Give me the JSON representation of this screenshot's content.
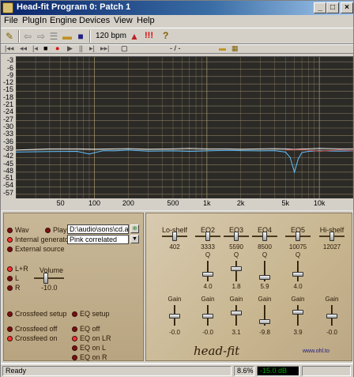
{
  "window": {
    "title": "Head-fit Program 0: Patch   1",
    "controls": {
      "minimize": "_",
      "maximize": "□",
      "close": "×"
    }
  },
  "menu": [
    "File",
    "PlugIn",
    "Engine",
    "Devices",
    "View",
    "Help"
  ],
  "toolbar": {
    "bpm": "120 bpm",
    "alert": "!!!",
    "help": "?"
  },
  "transport": {
    "position": "- / -"
  },
  "graph": {
    "y_ticks": [
      "-3",
      "-6",
      "-9",
      "-12",
      "-15",
      "-18",
      "-21",
      "-24",
      "-27",
      "-30",
      "-33",
      "-36",
      "-39",
      "-42",
      "-45",
      "-48",
      "-51",
      "-54",
      "-57"
    ],
    "x_ticks": [
      "50",
      "100",
      "200",
      "500",
      "1k",
      "2k",
      "5k",
      "10k"
    ],
    "background": "#2b2a27",
    "grid_color": "#a89870",
    "curve_white": "#f0f0f0",
    "curve_blue": "#60c0ff",
    "curve_red": "#c05050"
  },
  "chart_data": {
    "type": "line",
    "xscale": "log",
    "xlim": [
      20,
      20000
    ],
    "ylim": [
      -59,
      -1
    ],
    "x_ticks": [
      50,
      100,
      200,
      500,
      1000,
      2000,
      5000,
      10000
    ],
    "y_ticks": [
      -3,
      -6,
      -9,
      -12,
      -15,
      -18,
      -21,
      -24,
      -27,
      -30,
      -33,
      -36,
      -39,
      -42,
      -45,
      -48,
      -51,
      -54,
      -57
    ],
    "grid": true,
    "series": [
      {
        "color": "white",
        "x": [
          20,
          40,
          70,
          100,
          150,
          200,
          300,
          500,
          700,
          1000,
          1500,
          2000,
          3000,
          4000,
          5000,
          6000,
          7000,
          8000,
          10000,
          15000,
          20000
        ],
        "y": [
          -39,
          -38.5,
          -38.5,
          -38.6,
          -38.5,
          -38.4,
          -38.6,
          -38.5,
          -38.3,
          -38.5,
          -38.5,
          -38.6,
          -38.5,
          -38.4,
          -38.5,
          -38.7,
          -38.5,
          -38.5,
          -38.3,
          -38.5,
          -38.5
        ]
      },
      {
        "color": "blue",
        "x": [
          20,
          40,
          70,
          90,
          120,
          150,
          200,
          300,
          500,
          700,
          1000,
          1500,
          2000,
          3000,
          4000,
          5000,
          5500,
          6000,
          6500,
          7000,
          8000,
          10000,
          15000,
          20000
        ],
        "y": [
          -39.8,
          -39.6,
          -39.5,
          -40.6,
          -39.2,
          -39.3,
          -39,
          -39.4,
          -39.3,
          -39.5,
          -39.3,
          -39.1,
          -39.2,
          -39.3,
          -39.2,
          -39.8,
          -42,
          -48,
          -42.5,
          -40,
          -39.5,
          -39.3,
          -39.4,
          -39.3
        ]
      },
      {
        "color": "red",
        "x": [
          5000,
          7000,
          10000,
          15000,
          20000
        ],
        "y": [
          -39,
          -38.8,
          -39.5,
          -38.9,
          -39.2
        ]
      }
    ]
  },
  "source": {
    "wav": "Wav",
    "play": "Play",
    "file_path": "D:\\audio\\sons\\cd.au",
    "internal_generator": "Internal generator",
    "generator_type": "Pink correlated",
    "external_source": "External source"
  },
  "channels": {
    "lr": "L+R",
    "l": "L",
    "r": "R",
    "volume_label": "Volume",
    "volume_value": "-10.0"
  },
  "setup": {
    "crossfeed_setup": "Crossfeed setup",
    "eq_setup": "EQ setup",
    "crossfeed_off": "Crossfeed off",
    "crossfeed_on": "Crossfeed on",
    "eq_off": "EQ off",
    "eq_on_lr": "EQ on LR",
    "eq_on_l": "EQ on L",
    "eq_on_r": "EQ on R"
  },
  "eq": {
    "bands": [
      {
        "name": "Lo-shelf",
        "freq": "402",
        "q": "",
        "gain": "-0.0",
        "q_level": null,
        "gain_level": 0.5
      },
      {
        "name": "EQ2",
        "freq": "3333",
        "q": "4.0",
        "gain": "-0.0",
        "q_level": 0.35,
        "gain_level": 0.5
      },
      {
        "name": "EQ3",
        "freq": "5590",
        "q": "1.8",
        "gain": "3.1",
        "q_level": 0.7,
        "gain_level": 0.7
      },
      {
        "name": "EQ4",
        "freq": "8500",
        "q": "5.9",
        "gain": "-9.8",
        "q_level": 0.2,
        "gain_level": 0.2
      },
      {
        "name": "EQ5",
        "freq": "10075",
        "q": "4.0",
        "gain": "3.9",
        "q_level": 0.35,
        "gain_level": 0.75
      },
      {
        "name": "Hi-shelf",
        "freq": "12027",
        "q": "",
        "gain": "-0.0",
        "q_level": null,
        "gain_level": 0.5
      }
    ],
    "q_label": "Q",
    "gain_label": "Gain"
  },
  "brand": {
    "name": "head-fit",
    "url": "www.ohl.to"
  },
  "status": {
    "text": "Ready",
    "cpu": "8.6%",
    "level": "-15.0 dB"
  }
}
